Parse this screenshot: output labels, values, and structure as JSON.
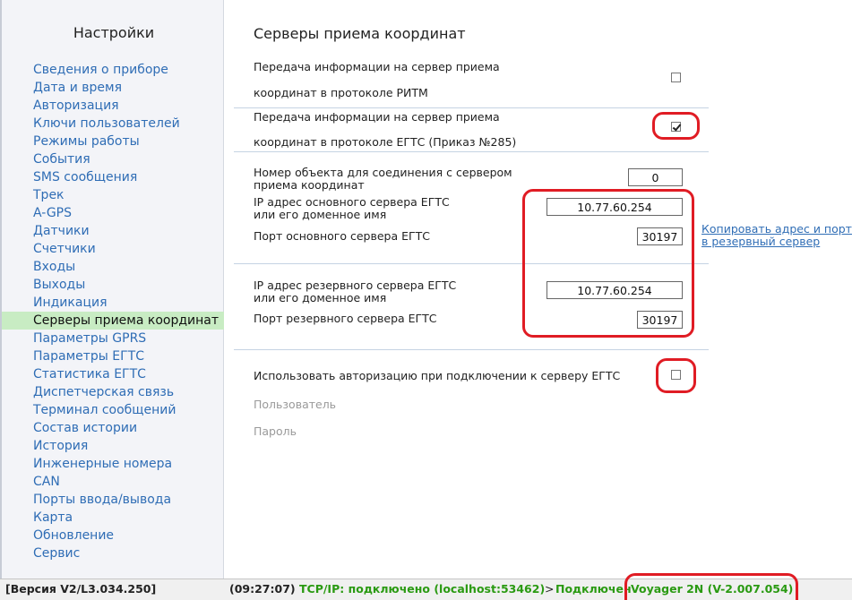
{
  "sidebar": {
    "title": "Настройки",
    "items": [
      {
        "label": "Сведения о приборе"
      },
      {
        "label": "Дата и время"
      },
      {
        "label": "Авторизация"
      },
      {
        "label": "Ключи пользователей"
      },
      {
        "label": "Режимы работы"
      },
      {
        "label": "События"
      },
      {
        "label": "SMS сообщения"
      },
      {
        "label": "Трек"
      },
      {
        "label": "A-GPS"
      },
      {
        "label": "Датчики"
      },
      {
        "label": "Счетчики"
      },
      {
        "label": "Входы"
      },
      {
        "label": "Выходы"
      },
      {
        "label": "Индикация"
      },
      {
        "label": "Серверы приема координат",
        "active": true
      },
      {
        "label": "Параметры GPRS"
      },
      {
        "label": "Параметры ЕГТС"
      },
      {
        "label": "Статистика ЕГТС"
      },
      {
        "label": "Диспетчерская связь"
      },
      {
        "label": "Терминал сообщений"
      },
      {
        "label": "Состав истории"
      },
      {
        "label": "История"
      },
      {
        "label": "Инженерные номера"
      },
      {
        "label": "CAN"
      },
      {
        "label": "Порты ввода/вывода"
      },
      {
        "label": "Карта"
      },
      {
        "label": "Обновление"
      },
      {
        "label": "Сервис"
      }
    ]
  },
  "main": {
    "title": "Серверы приема координат",
    "ritm": {
      "label_line1": "Передача информации на сервер приема",
      "label_line2": "координат в протоколе РИТМ",
      "checked": false
    },
    "egts": {
      "label_line1": "Передача информации на сервер приема",
      "label_line2": "координат в протоколе ЕГТС (Приказ №285)",
      "checked": true
    },
    "object_number": {
      "label_line1": "Номер объекта для соединения с сервером",
      "label_line2": "приема координат",
      "value": "0"
    },
    "primary_ip": {
      "label_line1": "IP адрес основного сервера ЕГТС",
      "label_line2": "или его доменное имя",
      "value": "10.77.60.254"
    },
    "primary_port": {
      "label": "Порт основного сервера ЕГТС",
      "value": "30197"
    },
    "copy_link": {
      "line1": "Копировать адрес и порт",
      "line2": "в резервный сервер"
    },
    "backup_ip": {
      "label_line1": "IP адрес резервного сервера ЕГТС",
      "label_line2": "или его доменное имя",
      "value": "10.77.60.254"
    },
    "backup_port": {
      "label": "Порт резервного сервера ЕГТС",
      "value": "30197"
    },
    "auth": {
      "label": "Использовать авторизацию при подключении к серверу ЕГТС",
      "checked": false,
      "user_label": "Пользователь",
      "password_label": "Пароль"
    }
  },
  "statusbar": {
    "version": "[Версия V2/L3.034.250]",
    "time": "(09:27:07)",
    "connection": "TCP/IP: подключено (localhost:53462)",
    "arrow": ">",
    "connected": "Подключен",
    "device": "Voyager 2N (V-2.007.054)"
  },
  "colors": {
    "link": "#2f6db5",
    "active_item_bg": "#c8ecc3",
    "status_green": "#2a9a12",
    "highlight_red": "#e01c24"
  }
}
